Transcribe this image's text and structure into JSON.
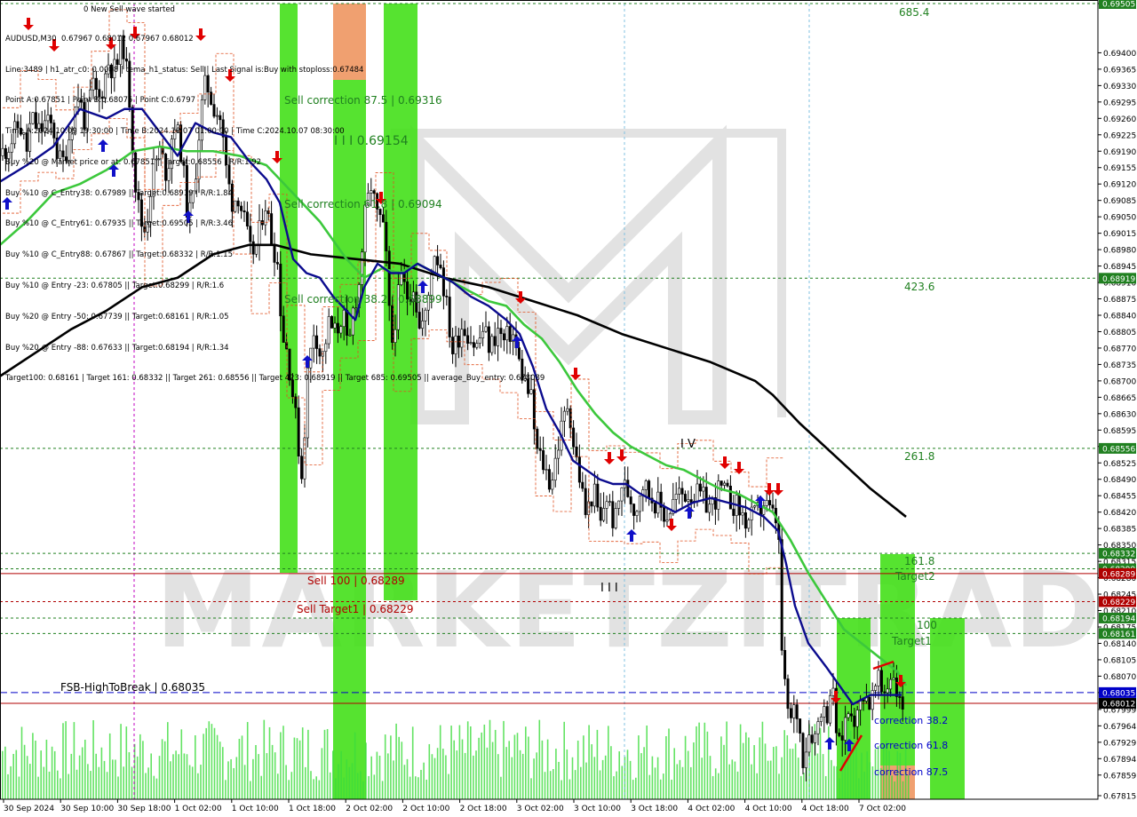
{
  "colors": {
    "background": "#ffffff",
    "candle": "#000000",
    "ma_fast": "#0b0b8e",
    "ma_mid": "#3cc83c",
    "ma_slow": "#000000",
    "green_zone": "#44e01a",
    "orange_zone": "#f0a070",
    "level_red": "#b00000",
    "level_green": "#208020",
    "level_blue": "#0000c8",
    "price_tag": "#000000",
    "volume": "#3cdc3c",
    "watermark": "#cccccc",
    "arrow_up": "#1010c8",
    "arrow_down": "#e00000",
    "fractal": "#e05020"
  },
  "info_panel": [
    "AUDUSD,M30  0.67967 0.68012 0.67967 0.68012",
    "Line:3489 | h1_atr_c0: 0.0008 | tema_h1_status: Sell | Last Signal is:Buy with stoploss:0.67484",
    "Point A:0.67851 | Point B:0.68075 | Point C:0.6797",
    "Time A:2024.10.09 19:30:00 | Time B:2024.10.07 01:00:00 | Time C:2024.10.07 08:30:00",
    "Buy %20 @ Market price or at: 0.67851 || Target:0.68556 | R/R:1.92",
    "Buy %10 @ C_Entry38: 0.67989 || Target:0.68919 | R/R:1.84",
    "Buy %10 @ C_Entry61: 0.67935 || Target:0.69505 | R/R:3.46",
    "Buy %10 @ C_Entry88: 0.67867 || Target:0.68332 | R/R:1.15",
    "Buy %10 @ Entry -23: 0.67805 || Target:0.68299 | R/R:1.6",
    "Buy %20 @ Entry -50: 0.67739 || Target:0.68161 | R/R:1.05",
    "Buy %20 @ Entry -88: 0.67633 || Target:0.68194 | R/R:1.34",
    "Target100: 0.68161 | Target 161: 0.68332 || Target 261: 0.68556 || Target 423: 0.68919 || Target 685: 0.69505 || average_Buy_entry: 0.678089"
  ],
  "wave_label": "0 New Sell wave started",
  "watermark_text": "MARKETZITRADE",
  "chart_data": {
    "type": "candlestick",
    "symbol": "AUDUSD",
    "timeframe": "M30",
    "ylim": [
      0.67815,
      0.69505
    ],
    "price_ticks": [
      "0.69505",
      "0.69400",
      "0.69365",
      "0.69330",
      "0.69295",
      "0.69260",
      "0.69225",
      "0.69190",
      "0.69155",
      "0.69120",
      "0.69085",
      "0.69050",
      "0.69015",
      "0.68980",
      "0.68945",
      "0.68910",
      "0.68875",
      "0.68840",
      "0.68805",
      "0.68770",
      "0.68735",
      "0.68700",
      "0.68665",
      "0.68630",
      "0.68595",
      "0.68560",
      "0.68525",
      "0.68490",
      "0.68455",
      "0.68420",
      "0.68385",
      "0.68350",
      "0.68315",
      "0.68280",
      "0.68245",
      "0.68210",
      "0.68175",
      "0.68140",
      "0.68105",
      "0.68070",
      "0.68035",
      "0.67999",
      "0.67964",
      "0.67929",
      "0.67894",
      "0.67859",
      "0.67815"
    ],
    "time_labels": [
      "30 Sep 2024",
      "30 Sep 10:00",
      "30 Sep 18:00",
      "1 Oct 02:00",
      "1 Oct 10:00",
      "1 Oct 18:00",
      "2 Oct 02:00",
      "2 Oct 10:00",
      "2 Oct 18:00",
      "3 Oct 02:00",
      "3 Oct 10:00",
      "3 Oct 18:00",
      "4 Oct 02:00",
      "4 Oct 10:00",
      "4 Oct 18:00",
      "7 Oct 02:00"
    ],
    "candle_path": [
      [
        0.6918,
        0
      ],
      [
        0.6921,
        12
      ],
      [
        0.6925,
        22
      ],
      [
        0.6919,
        30
      ],
      [
        0.6926,
        35
      ],
      [
        0.6923,
        45
      ],
      [
        0.6925,
        50
      ],
      [
        0.6924,
        60
      ],
      [
        0.6918,
        65
      ],
      [
        0.6916,
        70
      ],
      [
        0.6924,
        80
      ],
      [
        0.6931,
        88
      ],
      [
        0.6925,
        96
      ],
      [
        0.6933,
        104
      ],
      [
        0.693,
        112
      ],
      [
        0.6938,
        122
      ],
      [
        0.6936,
        130
      ],
      [
        0.6943,
        138
      ],
      [
        0.693,
        146
      ],
      [
        0.6913,
        152
      ],
      [
        0.6904,
        158
      ],
      [
        0.6902,
        164
      ],
      [
        0.6915,
        172
      ],
      [
        0.6919,
        180
      ],
      [
        0.6914,
        188
      ],
      [
        0.6926,
        196
      ],
      [
        0.6919,
        204
      ],
      [
        0.6904,
        212
      ],
      [
        0.691,
        218
      ],
      [
        0.6927,
        226
      ],
      [
        0.6934,
        232
      ],
      [
        0.6929,
        240
      ],
      [
        0.6926,
        248
      ],
      [
        0.6913,
        256
      ],
      [
        0.6908,
        262
      ],
      [
        0.691,
        268
      ],
      [
        0.6903,
        276
      ],
      [
        0.6897,
        282
      ],
      [
        0.6899,
        290
      ],
      [
        0.6909,
        298
      ],
      [
        0.69,
        306
      ],
      [
        0.6896,
        312
      ],
      [
        0.688,
        318
      ],
      [
        0.6876,
        324
      ],
      [
        0.686,
        334
      ],
      [
        0.6849,
        340
      ],
      [
        0.6871,
        346
      ],
      [
        0.6882,
        354
      ],
      [
        0.6874,
        362
      ],
      [
        0.6882,
        370
      ],
      [
        0.688,
        378
      ],
      [
        0.6885,
        386
      ],
      [
        0.6875,
        392
      ],
      [
        0.6886,
        398
      ],
      [
        0.689,
        404
      ],
      [
        0.6904,
        410
      ],
      [
        0.6912,
        418
      ],
      [
        0.6905,
        424
      ],
      [
        0.6904,
        430
      ],
      [
        0.6894,
        436
      ],
      [
        0.6876,
        440
      ],
      [
        0.6885,
        446
      ],
      [
        0.6892,
        452
      ],
      [
        0.6888,
        458
      ],
      [
        0.6891,
        466
      ],
      [
        0.6881,
        472
      ],
      [
        0.6884,
        480
      ],
      [
        0.6898,
        488
      ],
      [
        0.6895,
        496
      ],
      [
        0.6884,
        504
      ],
      [
        0.6876,
        510
      ],
      [
        0.6882,
        520
      ],
      [
        0.688,
        528
      ],
      [
        0.6877,
        536
      ],
      [
        0.6881,
        544
      ],
      [
        0.6877,
        552
      ],
      [
        0.6881,
        560
      ],
      [
        0.6878,
        568
      ],
      [
        0.6881,
        576
      ],
      [
        0.6874,
        584
      ],
      [
        0.6869,
        592
      ],
      [
        0.6866,
        598
      ],
      [
        0.6855,
        604
      ],
      [
        0.6853,
        610
      ],
      [
        0.6848,
        620
      ],
      [
        0.6858,
        630
      ],
      [
        0.6866,
        640
      ],
      [
        0.6856,
        646
      ],
      [
        0.685,
        652
      ],
      [
        0.6841,
        660
      ],
      [
        0.6847,
        668
      ],
      [
        0.6839,
        676
      ],
      [
        0.6846,
        682
      ],
      [
        0.6839,
        692
      ],
      [
        0.6848,
        700
      ],
      [
        0.6846,
        708
      ],
      [
        0.6842,
        716
      ],
      [
        0.6849,
        722
      ],
      [
        0.6846,
        730
      ],
      [
        0.6844,
        740
      ],
      [
        0.6841,
        750
      ],
      [
        0.6845,
        760
      ],
      [
        0.6846,
        770
      ],
      [
        0.6846,
        780
      ],
      [
        0.6845,
        790
      ],
      [
        0.6843,
        800
      ],
      [
        0.6847,
        810
      ],
      [
        0.6845,
        820
      ],
      [
        0.6843,
        830
      ],
      [
        0.684,
        840
      ],
      [
        0.6841,
        850
      ],
      [
        0.6844,
        860
      ],
      [
        0.6841,
        870
      ],
      [
        0.684,
        876
      ],
      [
        0.6813,
        880
      ],
      [
        0.6803,
        884
      ],
      [
        0.6797,
        890
      ],
      [
        0.6801,
        896
      ],
      [
        0.679,
        904
      ],
      [
        0.6796,
        912
      ],
      [
        0.6794,
        918
      ],
      [
        0.6801,
        924
      ],
      [
        0.6798,
        930
      ],
      [
        0.6806,
        936
      ],
      [
        0.6791,
        944
      ],
      [
        0.6798,
        952
      ],
      [
        0.6801,
        958
      ],
      [
        0.6797,
        964
      ],
      [
        0.6804,
        972
      ],
      [
        0.6801,
        980
      ],
      [
        0.6806,
        988
      ],
      [
        0.6803,
        994
      ],
      [
        0.6806,
        1000
      ],
      [
        0.6808,
        1006
      ],
      [
        0.6801,
        1012
      ],
      [
        0.6801,
        1018
      ]
    ],
    "ma_fast": [
      [
        0.69125,
        0
      ],
      [
        0.6916,
        30
      ],
      [
        0.692,
        60
      ],
      [
        0.6928,
        90
      ],
      [
        0.6926,
        120
      ],
      [
        0.6928,
        140
      ],
      [
        0.6928,
        160
      ],
      [
        0.6923,
        180
      ],
      [
        0.6918,
        200
      ],
      [
        0.6925,
        220
      ],
      [
        0.6923,
        240
      ],
      [
        0.6922,
        260
      ],
      [
        0.6917,
        280
      ],
      [
        0.6913,
        300
      ],
      [
        0.6908,
        315
      ],
      [
        0.6896,
        330
      ],
      [
        0.6893,
        345
      ],
      [
        0.6892,
        360
      ],
      [
        0.6888,
        375
      ],
      [
        0.6885,
        390
      ],
      [
        0.6883,
        400
      ],
      [
        0.689,
        410
      ],
      [
        0.6895,
        425
      ],
      [
        0.6893,
        440
      ],
      [
        0.6893,
        455
      ],
      [
        0.6895,
        470
      ],
      [
        0.6893,
        490
      ],
      [
        0.6891,
        510
      ],
      [
        0.6888,
        530
      ],
      [
        0.6886,
        550
      ],
      [
        0.6883,
        570
      ],
      [
        0.688,
        585
      ],
      [
        0.6873,
        600
      ],
      [
        0.6864,
        615
      ],
      [
        0.6859,
        630
      ],
      [
        0.6853,
        645
      ],
      [
        0.6851,
        660
      ],
      [
        0.6849,
        675
      ],
      [
        0.6848,
        690
      ],
      [
        0.6848,
        705
      ],
      [
        0.6846,
        720
      ],
      [
        0.6844,
        740
      ],
      [
        0.6842,
        760
      ],
      [
        0.6844,
        780
      ],
      [
        0.6845,
        800
      ],
      [
        0.6844,
        820
      ],
      [
        0.6843,
        840
      ],
      [
        0.6841,
        860
      ],
      [
        0.6838,
        876
      ],
      [
        0.6831,
        885
      ],
      [
        0.6822,
        895
      ],
      [
        0.6814,
        910
      ],
      [
        0.6809,
        930
      ],
      [
        0.6805,
        945
      ],
      [
        0.6801,
        960
      ],
      [
        0.6803,
        980
      ],
      [
        0.6803,
        1000
      ],
      [
        0.6803,
        1015
      ]
    ],
    "ma_mid": [
      [
        0.6899,
        0
      ],
      [
        0.6904,
        30
      ],
      [
        0.691,
        60
      ],
      [
        0.6912,
        90
      ],
      [
        0.6915,
        120
      ],
      [
        0.6919,
        150
      ],
      [
        0.692,
        180
      ],
      [
        0.6919,
        210
      ],
      [
        0.6919,
        240
      ],
      [
        0.6918,
        270
      ],
      [
        0.6916,
        300
      ],
      [
        0.691,
        330
      ],
      [
        0.6904,
        360
      ],
      [
        0.6896,
        390
      ],
      [
        0.6892,
        410
      ],
      [
        0.6894,
        430
      ],
      [
        0.6893,
        450
      ],
      [
        0.6895,
        470
      ],
      [
        0.6893,
        490
      ],
      [
        0.6891,
        510
      ],
      [
        0.6889,
        530
      ],
      [
        0.6887,
        550
      ],
      [
        0.6886,
        570
      ],
      [
        0.6882,
        590
      ],
      [
        0.6879,
        610
      ],
      [
        0.6874,
        630
      ],
      [
        0.6868,
        650
      ],
      [
        0.6863,
        670
      ],
      [
        0.6859,
        690
      ],
      [
        0.6856,
        710
      ],
      [
        0.6854,
        730
      ],
      [
        0.6852,
        750
      ],
      [
        0.6851,
        770
      ],
      [
        0.6849,
        790
      ],
      [
        0.6847,
        810
      ],
      [
        0.6846,
        830
      ],
      [
        0.6844,
        850
      ],
      [
        0.6842,
        870
      ],
      [
        0.6836,
        890
      ],
      [
        0.6829,
        910
      ],
      [
        0.6823,
        930
      ],
      [
        0.6817,
        950
      ],
      [
        0.6814,
        970
      ],
      [
        0.6811,
        990
      ],
      [
        0.6808,
        1010
      ],
      [
        0.6805,
        1020
      ]
    ],
    "ma_slow": [
      [
        0.6871,
        0
      ],
      [
        0.6876,
        40
      ],
      [
        0.6881,
        80
      ],
      [
        0.6885,
        120
      ],
      [
        0.689,
        160
      ],
      [
        0.6892,
        200
      ],
      [
        0.6897,
        240
      ],
      [
        0.6899,
        280
      ],
      [
        0.6899,
        310
      ],
      [
        0.6897,
        350
      ],
      [
        0.6896,
        400
      ],
      [
        0.6895,
        450
      ],
      [
        0.6892,
        500
      ],
      [
        0.689,
        550
      ],
      [
        0.6887,
        600
      ],
      [
        0.6884,
        650
      ],
      [
        0.688,
        700
      ],
      [
        0.6877,
        750
      ],
      [
        0.6874,
        800
      ],
      [
        0.687,
        850
      ],
      [
        0.6867,
        870
      ],
      [
        0.6861,
        900
      ],
      [
        0.6854,
        940
      ],
      [
        0.6847,
        980
      ],
      [
        0.6841,
        1020
      ]
    ],
    "levels": [
      {
        "price": 0.69505,
        "label": "685.4",
        "style": "green-dotted",
        "price_tag": "0.69505"
      },
      {
        "price": 0.68919,
        "label": "423.6",
        "style": "green-dashed",
        "price_tag": "0.68919"
      },
      {
        "price": 0.68556,
        "label": "261.8",
        "style": "green-dashed",
        "price_tag": "0.68556"
      },
      {
        "price": 0.68332,
        "label": "161.8",
        "style": "green-dashed",
        "price_tag": "0.68332"
      },
      {
        "price": 0.68299,
        "label": "Target2",
        "style": "green-dashed",
        "price_tag": "0.68299"
      },
      {
        "price": 0.68289,
        "label": "Sell 100 | 0.68289",
        "style": "red-solid",
        "price_tag": "0.68289"
      },
      {
        "price": 0.68229,
        "label": "Sell Target1 | 0.68229",
        "style": "red-dashed",
        "price_tag": "0.68229"
      },
      {
        "price": 0.68194,
        "label": "",
        "style": "green-dashed",
        "price_tag": "0.68194"
      },
      {
        "price": 0.68161,
        "label": "100",
        "style": "green-dashed",
        "price_tag": "0.68161"
      },
      {
        "price": 0.68035,
        "label": "FSB-HighToBreak | 0.68035",
        "style": "blue-dashed",
        "price_tag": "0.68035"
      },
      {
        "price": 0.68012,
        "label": "",
        "style": "red-solid",
        "price_tag": "0.68012"
      }
    ],
    "annotations": [
      {
        "text": "Sell correction 87.5 | 0.69316",
        "price": 0.69316,
        "time": 320,
        "color": "#208020"
      },
      {
        "text": "I I I 0.69154",
        "price": 0.69154,
        "time": 376,
        "color": "#208020"
      },
      {
        "text": "Sell correction 61.8 | 0.69094",
        "price": 0.69094,
        "time": 320,
        "color": "#208020"
      },
      {
        "text": "Sell correction 38.2 | 0.68899",
        "price": 0.68899,
        "time": 320,
        "color": "#208020"
      },
      {
        "text": "I V",
        "price": 0.6857,
        "time": 766,
        "color": "#000000"
      },
      {
        "text": "I I I",
        "price": 0.6827,
        "time": 676,
        "color": "#000000"
      },
      {
        "text": "Target1",
        "price": 0.6815,
        "time": 1004,
        "color": "#208020"
      },
      {
        "text": "correction 38.2",
        "price": 0.67989,
        "time": 984,
        "color": "#0000c8"
      },
      {
        "text": "correction 61.8",
        "price": 0.67935,
        "time": 984,
        "color": "#0000c8"
      },
      {
        "text": "correction 87.5",
        "price": 0.67867,
        "time": 984,
        "color": "#0000c8"
      }
    ]
  }
}
